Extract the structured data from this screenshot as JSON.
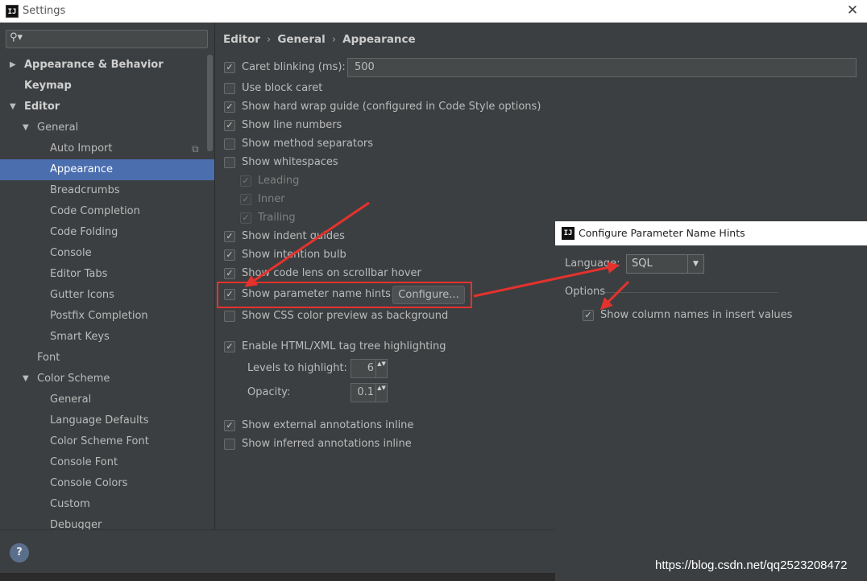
{
  "window": {
    "title": "Settings",
    "app_icon": "IJ",
    "close_glyph": "✕"
  },
  "search": {
    "value": "",
    "icon_glyph": "⚲▾"
  },
  "tree": {
    "items": [
      {
        "label": "Appearance & Behavior",
        "arrow": "▶"
      },
      {
        "label": "Keymap",
        "arrow": ""
      },
      {
        "label": "Editor",
        "arrow": "▼"
      },
      {
        "label": "General",
        "arrow": "▼"
      },
      {
        "label": "Auto Import",
        "arrow": ""
      },
      {
        "label": "Appearance",
        "arrow": ""
      },
      {
        "label": "Breadcrumbs",
        "arrow": ""
      },
      {
        "label": "Code Completion",
        "arrow": ""
      },
      {
        "label": "Code Folding",
        "arrow": ""
      },
      {
        "label": "Console",
        "arrow": ""
      },
      {
        "label": "Editor Tabs",
        "arrow": ""
      },
      {
        "label": "Gutter Icons",
        "arrow": ""
      },
      {
        "label": "Postfix Completion",
        "arrow": ""
      },
      {
        "label": "Smart Keys",
        "arrow": ""
      },
      {
        "label": "Font",
        "arrow": ""
      },
      {
        "label": "Color Scheme",
        "arrow": "▼"
      },
      {
        "label": "General",
        "arrow": ""
      },
      {
        "label": "Language Defaults",
        "arrow": ""
      },
      {
        "label": "Color Scheme Font",
        "arrow": ""
      },
      {
        "label": "Console Font",
        "arrow": ""
      },
      {
        "label": "Console Colors",
        "arrow": ""
      },
      {
        "label": "Custom",
        "arrow": ""
      },
      {
        "label": "Debugger",
        "arrow": ""
      }
    ],
    "copy_icon_glyph": "⧉"
  },
  "breadcrumb": {
    "part1": "Editor",
    "part2": "General",
    "part3": "Appearance",
    "sep": "›"
  },
  "options": {
    "caret_blinking": {
      "label": "Caret blinking (ms):",
      "value": "500"
    },
    "block_caret": {
      "label": "Use block caret"
    },
    "hard_wrap": {
      "label": "Show hard wrap guide (configured in Code Style options)"
    },
    "line_numbers": {
      "label": "Show line numbers"
    },
    "method_separators": {
      "label": "Show method separators"
    },
    "whitespaces": {
      "label": "Show whitespaces"
    },
    "leading": {
      "label": "Leading"
    },
    "inner": {
      "label": "Inner"
    },
    "trailing": {
      "label": "Trailing"
    },
    "indent_guides": {
      "label": "Show indent guides"
    },
    "intention_bulb": {
      "label": "Show intention bulb"
    },
    "code_lens": {
      "label": "Show code lens on scrollbar hover"
    },
    "param_hints": {
      "label": "Show parameter name hints",
      "button": "Configure..."
    },
    "css_color": {
      "label": "Show CSS color preview as background"
    },
    "tag_tree": {
      "label": "Enable HTML/XML tag tree highlighting"
    },
    "levels": {
      "label": "Levels to highlight:",
      "value": "6"
    },
    "opacity": {
      "label": "Opacity:",
      "value": "0.1"
    },
    "external_annotations": {
      "label": "Show external annotations inline"
    },
    "inferred_annotations": {
      "label": "Show inferred annotations inline"
    }
  },
  "glyphs": {
    "check": "✓",
    "spin": "▲▼",
    "help": "?",
    "chevron_down": "▼"
  },
  "dialog": {
    "title": "Configure Parameter Name Hints",
    "app_icon": "IJ",
    "language_label": "Language:",
    "language_value": "SQL",
    "options_label": "Options",
    "column_names": {
      "label": "Show column names in insert values"
    }
  },
  "watermark": "https://blog.csdn.net/qq2523208472",
  "colors": {
    "selection": "#4b6eaf",
    "annotation_red": "#e5322d",
    "background": "#3c3f41"
  }
}
